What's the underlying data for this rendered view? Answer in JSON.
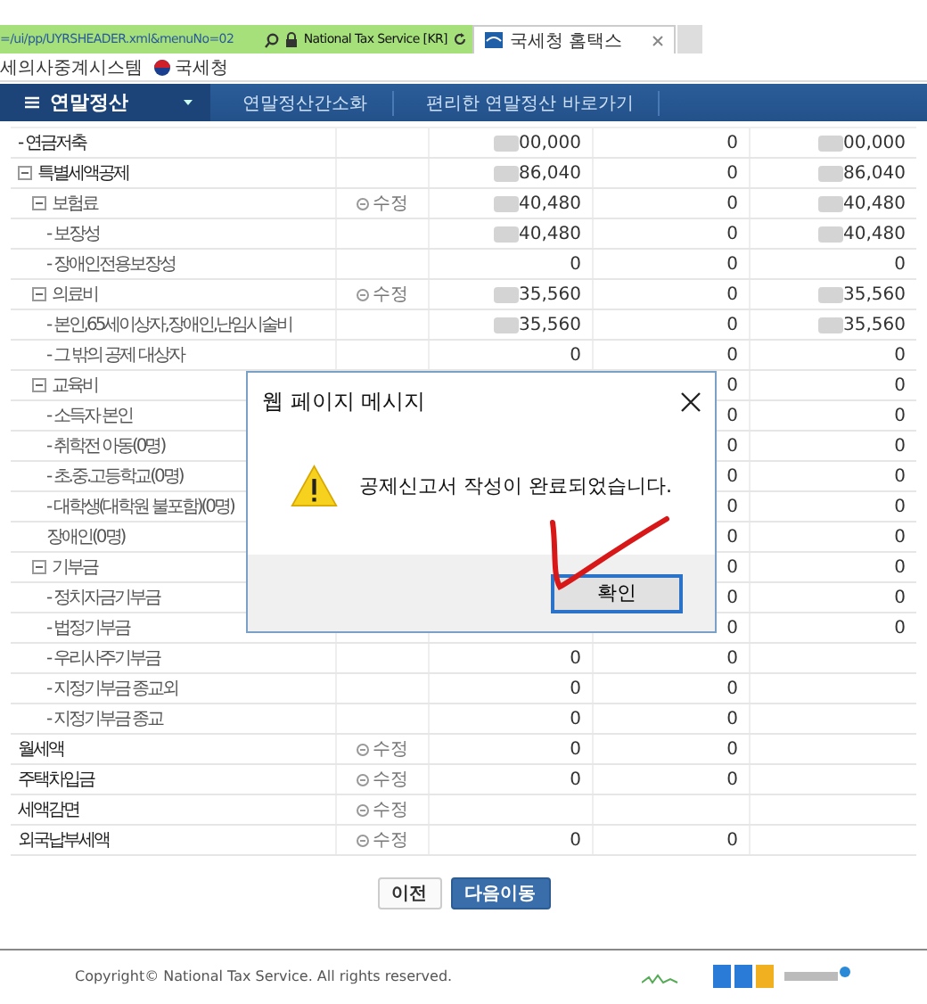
{
  "browser": {
    "address": "=/ui/pp/UYRSHEADER.xml&menuNo=02",
    "site_identity": "National Tax Service [KR]",
    "tabs": [
      {
        "label": "국세청 홈택스",
        "selected": true
      }
    ],
    "favorites": [
      "세의사중계시스템",
      "국세청"
    ]
  },
  "nav": {
    "menu": "연말정산",
    "breadcrumbs": [
      "연말정산간소화",
      "편리한 연말정산 바로가기"
    ]
  },
  "table": {
    "rows": [
      {
        "label": "- 연금저축",
        "column_3": "00,000",
        "column_4": "0",
        "column_5": "00,000",
        "redacted": true
      },
      {
        "label": "특별세액공제",
        "expanded": true,
        "column_3": "86,040",
        "column_4": "0",
        "column_5": "86,040",
        "redacted": true,
        "children": [
          {
            "label": "보험료",
            "expanded": true,
            "action": "수정",
            "column_3": "40,480",
            "column_4": "0",
            "column_5": "40,480",
            "redacted": true,
            "children": [
              {
                "label": "- 보장성",
                "column_3": "40,480",
                "column_4": "0",
                "column_5": "40,480",
                "redacted": true
              },
              {
                "label": "- 장애인전용보장성",
                "column_3": "0",
                "column_4": "0",
                "column_5": "0"
              }
            ]
          },
          {
            "label": "의료비",
            "expanded": true,
            "action": "수정",
            "column_3": "35,560",
            "column_4": "0",
            "column_5": "35,560",
            "redacted": true,
            "children": [
              {
                "label": "- 본인,65세이상자,장애인,난임시술비",
                "column_3": "35,560",
                "column_4": "0",
                "column_5": "35,560",
                "redacted": true
              },
              {
                "label": "- 그 밖의 공제 대상자",
                "column_3": "0",
                "column_4": "0",
                "column_5": "0"
              }
            ]
          },
          {
            "label": "교육비",
            "expanded": true,
            "column_4": "0",
            "column_5": "0",
            "children": [
              {
                "label": "- 소득자 본인",
                "column_4": "0",
                "column_5": "0"
              },
              {
                "label": "- 취학전 아동(0명)",
                "column_4": "0",
                "column_5": "0"
              },
              {
                "label": "- 초.중.고등학교(0명)",
                "column_4": "0",
                "column_5": "0"
              },
              {
                "label": "- 대학생(대학원 불포함)(0명)",
                "column_4": "0",
                "column_5": "0"
              },
              {
                "label": "장애인(0명)",
                "column_4": "0",
                "column_5": "0"
              }
            ]
          },
          {
            "label": "기부금",
            "expanded": true,
            "column_4": "0",
            "column_5": "0",
            "children": [
              {
                "label": "- 정치자금기부금",
                "column_4": "0",
                "column_5": "0"
              },
              {
                "label": "- 법정기부금",
                "column_4": "0",
                "column_5": "0"
              },
              {
                "label": "- 우리사주기부금",
                "column_3": "0",
                "column_4": "0"
              },
              {
                "label": "- 지정기부금 종교외",
                "column_3": "0",
                "column_4": "0"
              },
              {
                "label": "- 지정기부금 종교",
                "column_3": "0",
                "column_4": "0"
              }
            ]
          }
        ]
      },
      {
        "label": "월세액",
        "action": "수정",
        "column_3": "0",
        "column_4": "0"
      },
      {
        "label": "주택차입금",
        "action": "수정",
        "column_3": "0",
        "column_4": "0"
      },
      {
        "label": "세액감면",
        "action": "수정"
      },
      {
        "label": "외국납부세액",
        "action": "수정",
        "column_3": "0",
        "column_4": "0"
      }
    ]
  },
  "buttons": [
    {
      "label": "이전",
      "kind": "secondary"
    },
    {
      "label": "다음이동",
      "kind": "primary"
    }
  ],
  "footer": {
    "copyright": "Copyright© National Tax Service. All rights reserved."
  },
  "dialog": {
    "title": "웹 페이지 메시지",
    "message": "공제신고서 작성이 완료되었습니다.",
    "button": "확인"
  }
}
